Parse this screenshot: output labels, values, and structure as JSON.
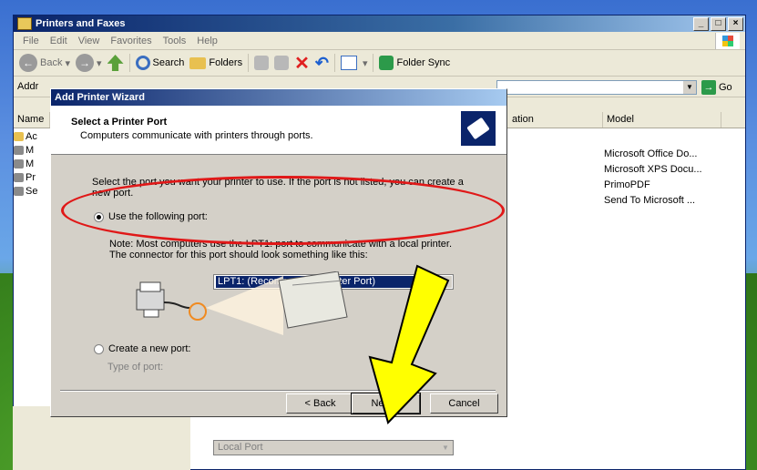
{
  "window": {
    "title": "Printers and Faxes",
    "controls": [
      "_",
      "□",
      "×"
    ]
  },
  "menu": [
    "File",
    "Edit",
    "View",
    "Favorites",
    "Tools",
    "Help"
  ],
  "toolbar": {
    "back": "Back",
    "search": "Search",
    "folders": "Folders",
    "folder_sync": "Folder Sync"
  },
  "address": {
    "label": "Addr",
    "go": "Go"
  },
  "list": {
    "headers": [
      "Name",
      "ation",
      "Model"
    ],
    "side_items": [
      "Ac",
      "M",
      "M",
      "Pr",
      "Se"
    ],
    "models": [
      "Microsoft Office Do...",
      "Microsoft XPS Docu...",
      "PrimoPDF",
      "Send To Microsoft ..."
    ]
  },
  "wizard": {
    "title": "Add Printer Wizard",
    "header_title": "Select a Printer Port",
    "header_subtitle": "Computers communicate with printers through ports.",
    "instruction": "Select the port you want your printer to use.  If the port is not listed, you can create a new port.",
    "use_port_label": "Use the following port:",
    "use_port_value": "LPT1: (Recommended Printer Port)",
    "note_line1": "Note: Most computers use the LPT1: port to communicate with a local printer.",
    "note_line2": "The connector for this port should look something like this:",
    "create_port_label": "Create a new port:",
    "type_of_port_label": "Type of port:",
    "type_of_port_value": "Local Port",
    "back_button": "< Back",
    "next_button": "Next >",
    "cancel_button": "Cancel"
  },
  "colors": {
    "titlebar": "#0a246a",
    "annotation_ellipse": "#e01818",
    "annotation_arrow": "#ffff00"
  }
}
